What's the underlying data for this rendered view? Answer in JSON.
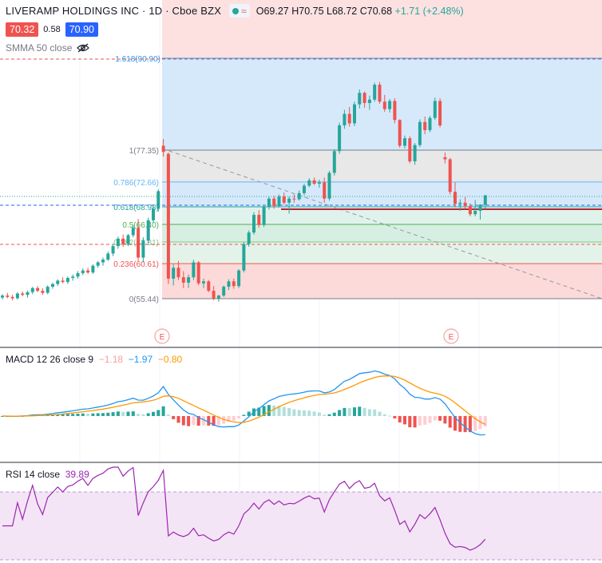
{
  "header": {
    "symbol": "LIVERAMP HOLDINGS INC · 1D · Cboe BZX",
    "open": "O69.27",
    "high": "H70.75",
    "low": "L68.72",
    "close": "C70.68",
    "change": "+1.71 (+2.48%)",
    "bid": "70.32",
    "spread": "0.58",
    "ask": "70.90"
  },
  "indicators": {
    "smma_label": "SMMA 50 close",
    "macd_label": "MACD 12 26 close 9",
    "macd_hist": "−1.18",
    "macd_line": "−1.97",
    "macd_signal": "−0.80",
    "rsi_label": "RSI 14 close",
    "rsi_value": "39.89"
  },
  "fib_labels": [
    "1.618(90.90)",
    "1(77.35)",
    "0.786(72.66)",
    "0.618(68.98)",
    "0.5(66.40)",
    "0.382(63.81)",
    "0.236(60.61)",
    "0(55.44)"
  ],
  "events": [
    "E",
    "E"
  ],
  "colors": {
    "up": "#26a69a",
    "down": "#ef5350",
    "macd": "#2196f3",
    "signal": "#ff9800",
    "rsi": "#9c27b0"
  },
  "chart_data": {
    "type": "candlestick",
    "candles": [
      [
        55.6,
        56.1,
        55.3,
        55.9
      ],
      [
        55.9,
        56.3,
        55.5,
        55.7
      ],
      [
        55.7,
        56.0,
        55.2,
        55.5
      ],
      [
        55.5,
        56.4,
        55.3,
        56.2
      ],
      [
        56.2,
        56.5,
        55.8,
        56.0
      ],
      [
        56.0,
        56.6,
        55.6,
        56.4
      ],
      [
        56.4,
        57.2,
        56.1,
        57.0
      ],
      [
        57.0,
        57.3,
        56.4,
        56.6
      ],
      [
        56.6,
        57.0,
        56.0,
        56.3
      ],
      [
        56.3,
        57.4,
        56.1,
        57.2
      ],
      [
        57.2,
        57.8,
        56.9,
        57.6
      ],
      [
        57.6,
        58.3,
        57.3,
        58.1
      ],
      [
        58.1,
        58.6,
        57.7,
        57.9
      ],
      [
        57.9,
        58.7,
        57.6,
        58.5
      ],
      [
        58.5,
        59.0,
        58.1,
        58.7
      ],
      [
        58.7,
        59.5,
        58.4,
        59.2
      ],
      [
        59.2,
        59.9,
        58.9,
        59.6
      ],
      [
        59.6,
        60.0,
        59.1,
        59.3
      ],
      [
        59.3,
        60.5,
        59.1,
        60.3
      ],
      [
        60.3,
        61.0,
        60.0,
        60.8
      ],
      [
        60.8,
        61.5,
        60.3,
        61.2
      ],
      [
        61.2,
        62.4,
        61.0,
        62.1
      ],
      [
        62.1,
        63.5,
        61.7,
        63.2
      ],
      [
        63.2,
        64.6,
        62.8,
        64.3
      ],
      [
        64.3,
        64.9,
        63.1,
        63.5
      ],
      [
        63.5,
        65.0,
        63.2,
        64.8
      ],
      [
        64.8,
        66.3,
        64.5,
        65.9
      ],
      [
        65.9,
        67.2,
        61.0,
        61.5
      ],
      [
        61.5,
        64.5,
        60.8,
        64.0
      ],
      [
        64.0,
        67.4,
        63.6,
        67.0
      ],
      [
        67.0,
        69.0,
        66.6,
        68.7
      ],
      [
        68.7,
        71.6,
        68.3,
        71.3
      ],
      [
        78.0,
        79.0,
        76.4,
        77.1
      ],
      [
        76.8,
        77.0,
        57.6,
        58.4
      ],
      [
        58.4,
        60.5,
        57.4,
        60.0
      ],
      [
        60.0,
        61.0,
        58.2,
        58.6
      ],
      [
        58.6,
        59.5,
        57.0,
        57.8
      ],
      [
        57.8,
        59.0,
        57.0,
        58.6
      ],
      [
        58.6,
        61.2,
        58.2,
        60.8
      ],
      [
        60.8,
        61.0,
        57.4,
        57.7
      ],
      [
        57.7,
        58.4,
        57.0,
        58.0
      ],
      [
        58.0,
        58.2,
        56.4,
        56.6
      ],
      [
        56.6,
        57.3,
        55.2,
        55.5
      ],
      [
        55.5,
        56.0,
        55.0,
        55.9
      ],
      [
        55.9,
        57.4,
        55.7,
        57.2
      ],
      [
        57.2,
        58.3,
        56.7,
        58.0
      ],
      [
        58.0,
        58.4,
        56.9,
        57.3
      ],
      [
        57.3,
        59.8,
        57.0,
        59.6
      ],
      [
        59.6,
        63.8,
        59.3,
        63.5
      ],
      [
        63.5,
        65.5,
        63.1,
        65.2
      ],
      [
        65.2,
        68.2,
        64.9,
        67.8
      ],
      [
        67.8,
        68.5,
        65.9,
        66.3
      ],
      [
        66.3,
        69.3,
        66.0,
        69.0
      ],
      [
        69.0,
        70.5,
        68.6,
        70.2
      ],
      [
        70.2,
        70.6,
        68.7,
        69.1
      ],
      [
        69.1,
        70.8,
        68.9,
        70.5
      ],
      [
        70.5,
        71.1,
        69.3,
        69.6
      ],
      [
        69.6,
        70.5,
        68.0,
        70.2
      ],
      [
        70.2,
        70.8,
        69.6,
        70.1
      ],
      [
        70.1,
        71.4,
        69.9,
        71.0
      ],
      [
        71.0,
        72.4,
        70.7,
        72.1
      ],
      [
        72.1,
        73.2,
        71.9,
        72.9
      ],
      [
        72.9,
        73.3,
        72.2,
        72.4
      ],
      [
        72.4,
        73.0,
        71.8,
        72.6
      ],
      [
        72.6,
        73.3,
        69.6,
        70.2
      ],
      [
        70.2,
        74.3,
        69.9,
        74.0
      ],
      [
        74.0,
        77.5,
        73.6,
        77.2
      ],
      [
        77.2,
        81.4,
        76.8,
        81.0
      ],
      [
        81.0,
        83.3,
        80.5,
        82.7
      ],
      [
        82.7,
        83.7,
        80.8,
        81.3
      ],
      [
        81.3,
        84.5,
        80.9,
        84.1
      ],
      [
        84.1,
        86.3,
        83.5,
        85.8
      ],
      [
        85.8,
        86.0,
        83.6,
        84.3
      ],
      [
        84.3,
        85.4,
        83.3,
        84.8
      ],
      [
        84.8,
        87.3,
        84.5,
        87.0
      ],
      [
        87.0,
        87.4,
        84.2,
        84.5
      ],
      [
        84.5,
        85.5,
        83.0,
        83.4
      ],
      [
        83.4,
        84.9,
        82.9,
        84.6
      ],
      [
        84.6,
        85.0,
        81.3,
        81.8
      ],
      [
        81.8,
        81.9,
        77.7,
        78.0
      ],
      [
        78.0,
        79.5,
        77.6,
        79.1
      ],
      [
        79.1,
        79.4,
        75.4,
        75.7
      ],
      [
        75.7,
        78.4,
        75.2,
        78.1
      ],
      [
        78.1,
        81.9,
        77.8,
        81.5
      ],
      [
        81.5,
        82.3,
        79.7,
        80.3
      ],
      [
        80.3,
        82.4,
        80.0,
        82.1
      ],
      [
        82.1,
        85.1,
        81.8,
        84.6
      ],
      [
        84.6,
        85.0,
        80.7,
        81.0
      ],
      [
        76.3,
        77.0,
        75.4,
        76.0
      ],
      [
        76.0,
        76.2,
        70.8,
        71.2
      ],
      [
        71.2,
        72.6,
        68.9,
        69.4
      ],
      [
        69.4,
        70.1,
        68.4,
        69.6
      ],
      [
        69.6,
        70.4,
        68.7,
        69.1
      ],
      [
        69.1,
        69.5,
        67.6,
        67.9
      ],
      [
        67.9,
        70.0,
        67.6,
        68.4
      ],
      [
        68.4,
        69.4,
        67.1,
        69.3
      ],
      [
        69.27,
        70.75,
        68.72,
        70.68
      ]
    ]
  }
}
